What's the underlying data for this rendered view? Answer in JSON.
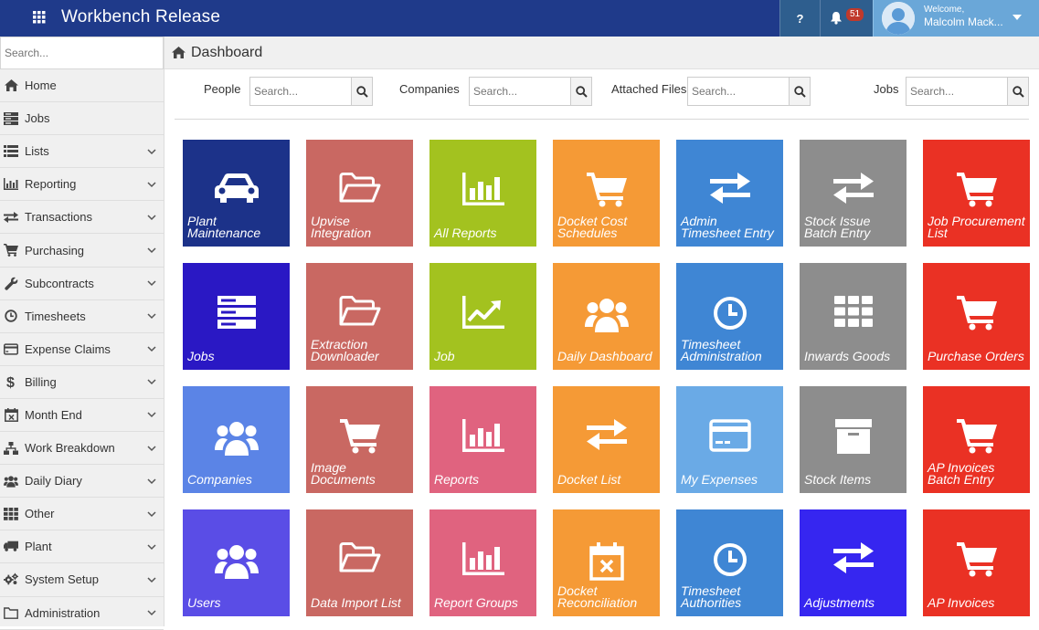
{
  "app": {
    "title": "Workbench Release"
  },
  "header": {
    "help_label": "?",
    "notification_count": "51",
    "welcome": "Welcome,",
    "user_name": "Malcolm Mack..."
  },
  "sidebar": {
    "search_placeholder": "Search...",
    "items": [
      {
        "label": "Home",
        "icon": "home-icon",
        "has_children": false
      },
      {
        "label": "Jobs",
        "icon": "jobs-icon",
        "has_children": false
      },
      {
        "label": "Lists",
        "icon": "list-icon",
        "has_children": true
      },
      {
        "label": "Reporting",
        "icon": "bar-chart-icon",
        "has_children": true
      },
      {
        "label": "Transactions",
        "icon": "exchange-icon",
        "has_children": true
      },
      {
        "label": "Purchasing",
        "icon": "cart-icon",
        "has_children": true
      },
      {
        "label": "Subcontracts",
        "icon": "wrench-icon",
        "has_children": true
      },
      {
        "label": "Timesheets",
        "icon": "clock-icon",
        "has_children": true
      },
      {
        "label": "Expense Claims",
        "icon": "credit-card-icon",
        "has_children": true
      },
      {
        "label": "Billing",
        "icon": "dollar-icon",
        "has_children": true
      },
      {
        "label": "Month End",
        "icon": "calendar-x-icon",
        "has_children": true
      },
      {
        "label": "Work Breakdown",
        "icon": "sitemap-icon",
        "has_children": true
      },
      {
        "label": "Daily Diary",
        "icon": "users-icon",
        "has_children": true
      },
      {
        "label": "Other",
        "icon": "grid-icon",
        "has_children": true
      },
      {
        "label": "Plant",
        "icon": "truck-icon",
        "has_children": true
      },
      {
        "label": "System Setup",
        "icon": "gears-icon",
        "has_children": true
      },
      {
        "label": "Administration",
        "icon": "folder-icon",
        "has_children": true
      }
    ]
  },
  "breadcrumb": {
    "label": "Dashboard"
  },
  "search_fields": [
    {
      "label": "People",
      "placeholder": "Search..."
    },
    {
      "label": "Companies",
      "placeholder": "Search..."
    },
    {
      "label": "Attached Files",
      "placeholder": "Search..."
    },
    {
      "label": "Jobs",
      "placeholder": "Search..."
    }
  ],
  "tiles": [
    {
      "label": "Plant Maintenance",
      "icon": "car-icon",
      "color": "#1c3289"
    },
    {
      "label": "Upvise Integration",
      "icon": "folder-open-icon",
      "color": "#c96862"
    },
    {
      "label": "All Reports",
      "icon": "bar-chart-icon",
      "color": "#a3c21f"
    },
    {
      "label": "Docket Cost Schedules",
      "icon": "cart-icon",
      "color": "#f59a36"
    },
    {
      "label": "Admin Timesheet Entry",
      "icon": "exchange-icon",
      "color": "#3f86d4"
    },
    {
      "label": "Stock Issue Batch Entry",
      "icon": "exchange-icon",
      "color": "#8d8d8d"
    },
    {
      "label": "Job Procurement List",
      "icon": "cart-icon",
      "color": "#ea3124"
    },
    {
      "label": "Jobs",
      "icon": "server-icon",
      "color": "#2a18c4"
    },
    {
      "label": "Extraction Downloader",
      "icon": "folder-open-icon",
      "color": "#c96862"
    },
    {
      "label": "Job",
      "icon": "line-chart-icon",
      "color": "#a3c21f"
    },
    {
      "label": "Daily Dashboard",
      "icon": "users-icon",
      "color": "#f59a36"
    },
    {
      "label": "Timesheet Administration",
      "icon": "clock-icon",
      "color": "#3f86d4"
    },
    {
      "label": "Inwards Goods",
      "icon": "grid-icon",
      "color": "#8d8d8d"
    },
    {
      "label": "Purchase Orders",
      "icon": "cart-icon",
      "color": "#ea3124"
    },
    {
      "label": "Companies",
      "icon": "users-icon",
      "color": "#5b84e6"
    },
    {
      "label": "Image Documents",
      "icon": "cart-icon",
      "color": "#c96862"
    },
    {
      "label": "Reports",
      "icon": "bar-chart-icon",
      "color": "#e0637f"
    },
    {
      "label": "Docket List",
      "icon": "exchange-icon",
      "color": "#f59a36"
    },
    {
      "label": "My Expenses",
      "icon": "credit-card-icon",
      "color": "#6aaae6"
    },
    {
      "label": "Stock Items",
      "icon": "archive-icon",
      "color": "#8d8d8d"
    },
    {
      "label": "AP Invoices Batch Entry",
      "icon": "cart-icon",
      "color": "#ea3124"
    },
    {
      "label": "Users",
      "icon": "users-icon",
      "color": "#5a4de6"
    },
    {
      "label": "Data Import List",
      "icon": "folder-open-icon",
      "color": "#c96862"
    },
    {
      "label": "Report Groups",
      "icon": "bar-chart-icon",
      "color": "#e0637f"
    },
    {
      "label": "Docket Reconciliation",
      "icon": "calendar-x-icon",
      "color": "#f59a36"
    },
    {
      "label": "Timesheet Authorities",
      "icon": "clock-icon",
      "color": "#3f86d4"
    },
    {
      "label": "Adjustments",
      "icon": "exchange-icon",
      "color": "#3626f0"
    },
    {
      "label": "AP Invoices",
      "icon": "cart-icon",
      "color": "#ea3124"
    }
  ]
}
